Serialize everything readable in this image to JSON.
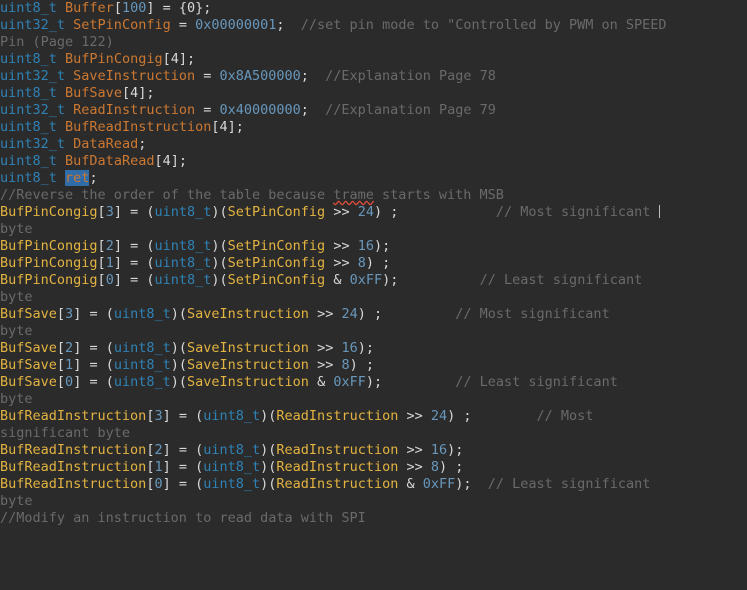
{
  "editor": {
    "background_color": "#2b2b2b",
    "selection_color": "#2f6ca8",
    "caret_color": "#bbbbbb",
    "type_color": "#2f82b5",
    "identifier_color": "#cc7832",
    "variable_color": "#e3b341",
    "number_color": "#6897bb",
    "comment_color": "#6a6a6a",
    "punctuation_color": "#d8d8d8",
    "language": "C"
  },
  "lines": {
    "l01": {
      "type": "uint8_t",
      "sp1": " ",
      "name": "Buffer",
      "br": "[",
      "idx": "100",
      "brc": "]",
      "eq": " = ",
      "val": "{0};"
    },
    "l02": {
      "type": "uint32_t",
      "name": "SetPinConfig",
      "eq": " = ",
      "num": "0x00000001",
      "semi": ";",
      "comment": "  //set pin mode to \"Controlled by PWM on SPEED"
    },
    "l03": {
      "comment": "Pin (Page 122)"
    },
    "l04": {
      "type": "uint8_t",
      "name": "BufPinCongig",
      "rest": "[4];"
    },
    "l05": {
      "type": "uint32_t",
      "name": "SaveInstruction",
      "eq": " = ",
      "num": "0x8A500000",
      "semi": ";",
      "comment": "  //Explanation Page 78"
    },
    "l06": {
      "type": "uint8_t",
      "name": "BufSave",
      "rest": "[4];"
    },
    "l07": {
      "type": "uint32_t",
      "name": "ReadInstruction",
      "eq": " = ",
      "num": "0x40000000",
      "semi": ";",
      "comment": "  //Explanation Page 79"
    },
    "l08": {
      "type": "uint8_t",
      "name": "BufReadInstruction",
      "rest": "[4];"
    },
    "l09": {
      "type": "uint32_t",
      "name": "DataRead",
      "rest": ";"
    },
    "l10": {
      "type": "uint8_t",
      "name": "BufDataRead",
      "rest": "[4];"
    },
    "l11": {
      "type": "uint8_t",
      "selected": "ret",
      "rest": ";"
    },
    "l12": {
      "pre": "//Reverse the order of the table because ",
      "misspelled": "trame",
      "post": " starts with MSB"
    },
    "l13": {
      "var": "BufPinCongig",
      "b1": "[",
      "idx": "3",
      "b2": "]",
      "eq": " = (",
      "cast": "uint8_t",
      "p1": ")(",
      "src": "SetPinConfig",
      "op": " >> ",
      "shift": "24",
      "tail": ") ;",
      "gap": "            ",
      "comment": "// Most significant "
    },
    "l14": {
      "comment": "byte"
    },
    "l15": {
      "var": "BufPinCongig",
      "b1": "[",
      "idx": "2",
      "b2": "]",
      "eq": " = (",
      "cast": "uint8_t",
      "p1": ")(",
      "src": "SetPinConfig",
      "op": " >> ",
      "shift": "16",
      "tail": ");"
    },
    "l16": {
      "var": "BufPinCongig",
      "b1": "[",
      "idx": "1",
      "b2": "]",
      "eq": " = (",
      "cast": "uint8_t",
      "p1": ")(",
      "src": "SetPinConfig",
      "op": " >> ",
      "shift": "8",
      "tail": ") ;"
    },
    "l17": {
      "var": "BufPinCongig",
      "b1": "[",
      "idx": "0",
      "b2": "]",
      "eq": " = (",
      "cast": "uint8_t",
      "p1": ")(",
      "src": "SetPinConfig",
      "op": " & ",
      "shift": "0xFF",
      "tail": ");",
      "gap": "          ",
      "comment": "// Least significant"
    },
    "l18": {
      "comment": "byte"
    },
    "l19": {
      "var": "BufSave",
      "b1": "[",
      "idx": "3",
      "b2": "]",
      "eq": " = (",
      "cast": "uint8_t",
      "p1": ")(",
      "src": "SaveInstruction",
      "op": " >> ",
      "shift": "24",
      "tail": ") ;",
      "gap": "         ",
      "comment": "// Most significant"
    },
    "l20": {
      "comment": "byte"
    },
    "l21": {
      "var": "BufSave",
      "b1": "[",
      "idx": "2",
      "b2": "]",
      "eq": " = (",
      "cast": "uint8_t",
      "p1": ")(",
      "src": "SaveInstruction",
      "op": " >> ",
      "shift": "16",
      "tail": ");"
    },
    "l22": {
      "var": "BufSave",
      "b1": "[",
      "idx": "1",
      "b2": "]",
      "eq": " = (",
      "cast": "uint8_t",
      "p1": ")(",
      "src": "SaveInstruction",
      "op": " >> ",
      "shift": "8",
      "tail": ") ;"
    },
    "l23": {
      "var": "BufSave",
      "b1": "[",
      "idx": "0",
      "b2": "]",
      "eq": " = (",
      "cast": "uint8_t",
      "p1": ")(",
      "src": "SaveInstruction",
      "op": " & ",
      "shift": "0xFF",
      "tail": ");",
      "gap": "         ",
      "comment": "// Least significant"
    },
    "l24": {
      "comment": "byte"
    },
    "l25": {
      "var": "BufReadInstruction",
      "b1": "[",
      "idx": "3",
      "b2": "]",
      "eq": " = (",
      "cast": "uint8_t",
      "p1": ")(",
      "src": "ReadInstruction",
      "op": " >> ",
      "shift": "24",
      "tail": ") ;",
      "gap": "        ",
      "comment": "// Most"
    },
    "l26": {
      "comment": "significant byte"
    },
    "l27": {
      "var": "BufReadInstruction",
      "b1": "[",
      "idx": "2",
      "b2": "]",
      "eq": " = (",
      "cast": "uint8_t",
      "p1": ")(",
      "src": "ReadInstruction",
      "op": " >> ",
      "shift": "16",
      "tail": ");"
    },
    "l28": {
      "var": "BufReadInstruction",
      "b1": "[",
      "idx": "1",
      "b2": "]",
      "eq": " = (",
      "cast": "uint8_t",
      "p1": ")(",
      "src": "ReadInstruction",
      "op": " >> ",
      "shift": "8",
      "tail": ") ;"
    },
    "l29": {
      "var": "BufReadInstruction",
      "b1": "[",
      "idx": "0",
      "b2": "]",
      "eq": " = (",
      "cast": "uint8_t",
      "p1": ")(",
      "src": "ReadInstruction",
      "op": " & ",
      "shift": "0xFF",
      "tail": ");",
      "gap": "  ",
      "comment": "// Least significant"
    },
    "l30": {
      "comment": "byte"
    },
    "l31": {
      "comment": "//Modify an instruction to read data with SPI"
    }
  }
}
